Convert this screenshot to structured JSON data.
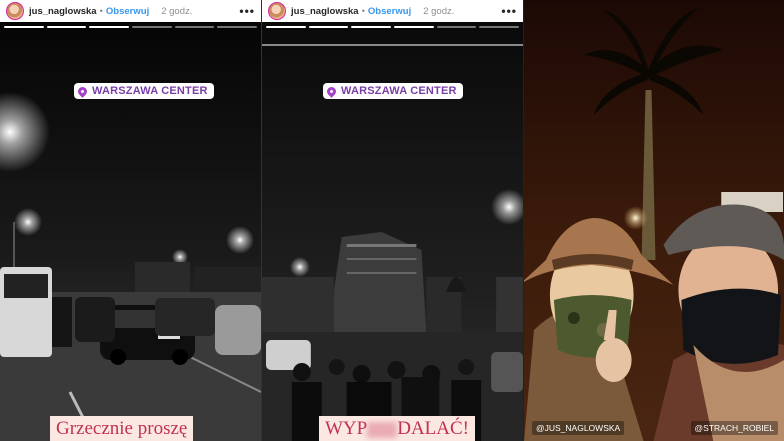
{
  "stories": [
    {
      "username": "jus_naglowska",
      "separator": "•",
      "follow_label": "Obserwuj",
      "time": "2 godz.",
      "more_label": "•••",
      "location": "WARSZAWA CENTER",
      "caption": "Grzecznie proszę"
    },
    {
      "username": "jus_naglowska",
      "separator": "•",
      "follow_label": "Obserwuj",
      "time": "2 godz.",
      "more_label": "•••",
      "location": "WARSZAWA CENTER",
      "caption_start": "WYP",
      "caption_end": "DALAĆ!"
    },
    {
      "tag_left": "@JUS_NAGLOWSKA",
      "tag_right": "@STRACH_ROBIEL"
    }
  ],
  "colors": {
    "follow": "#3897f0",
    "location_text": "#7a3fa6",
    "caption_text": "#c2314e",
    "caption_bg": "#fbe8e2"
  }
}
